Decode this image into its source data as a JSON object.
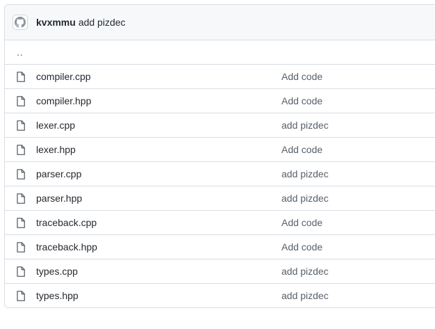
{
  "header": {
    "author": "kvxmmu",
    "message": "add pizdec"
  },
  "parent_link": "..",
  "files": [
    {
      "name": "compiler.cpp",
      "commit": "Add code"
    },
    {
      "name": "compiler.hpp",
      "commit": "Add code"
    },
    {
      "name": "lexer.cpp",
      "commit": "add pizdec"
    },
    {
      "name": "lexer.hpp",
      "commit": "Add code"
    },
    {
      "name": "parser.cpp",
      "commit": "add pizdec"
    },
    {
      "name": "parser.hpp",
      "commit": "add pizdec"
    },
    {
      "name": "traceback.cpp",
      "commit": "Add code"
    },
    {
      "name": "traceback.hpp",
      "commit": "Add code"
    },
    {
      "name": "types.cpp",
      "commit": "add pizdec"
    },
    {
      "name": "types.hpp",
      "commit": "add pizdec"
    }
  ],
  "colors": {
    "link": "#0969da",
    "text": "#24292f",
    "muted": "#57606a",
    "header_bg": "#f6f8fa",
    "border": "#d8dee4"
  },
  "icons": {
    "avatar": "github-avatar-icon",
    "file": "file-icon"
  }
}
